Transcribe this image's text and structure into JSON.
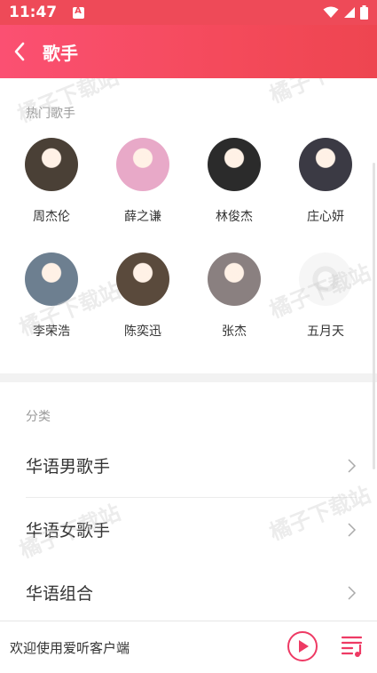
{
  "status_bar": {
    "time": "11:47"
  },
  "header": {
    "title": "歌手",
    "back_icon": "chevron-left-icon"
  },
  "hot_singers": {
    "section_title": "热门歌手",
    "items": [
      {
        "name": "周杰伦",
        "tone": "#4a4036"
      },
      {
        "name": "薛之谦",
        "tone": "#e8a9c8"
      },
      {
        "name": "林俊杰",
        "tone": "#2b2b2b"
      },
      {
        "name": "庄心妍",
        "tone": "#3b3a44"
      },
      {
        "name": "李荣浩",
        "tone": "#6d7f90"
      },
      {
        "name": "陈奕迅",
        "tone": "#5a4a3c"
      },
      {
        "name": "张杰",
        "tone": "#8a8080"
      },
      {
        "name": "五月天",
        "tone": "#f1f1f1"
      }
    ]
  },
  "categories": {
    "section_title": "分类",
    "items": [
      {
        "label": "华语男歌手"
      },
      {
        "label": "华语女歌手"
      },
      {
        "label": "华语组合"
      }
    ]
  },
  "watermark_text": "橘子下载站",
  "player": {
    "message": "欢迎使用爱听客户端",
    "play_icon": "play-circle-icon",
    "playlist_icon": "playlist-icon"
  },
  "colors": {
    "accent": "#ee4a58",
    "accent_pink": "#fb5072"
  }
}
